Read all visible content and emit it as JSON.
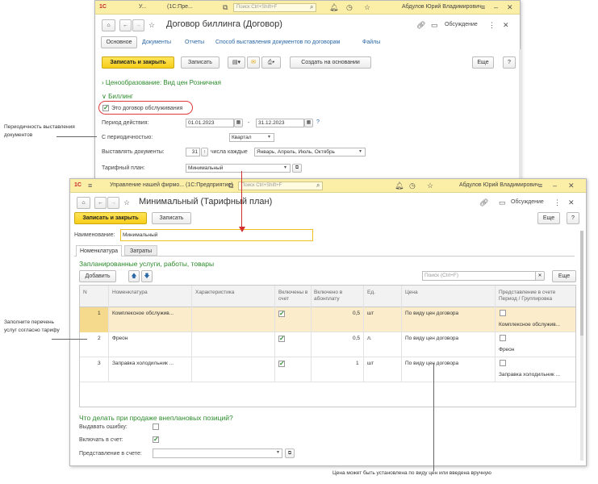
{
  "back_window": {
    "title_short": "У...",
    "app_short": "(1С:Пре...",
    "search_placeholder": "Поиск Ctrl+Shift+F",
    "user": "Абдулов Юрий Владимирович",
    "doc_title": "Договор биллинга (Договор)",
    "discussion": "Обсуждение",
    "tabs": [
      "Основное",
      "Документы",
      "Отчеты",
      "Способ выставления документов по договорам",
      "Файлы"
    ],
    "btn_save_close": "Записать и закрыть",
    "btn_save": "Записать",
    "btn_create_basis": "Создать на основании",
    "btn_more": "Еще",
    "btn_help": "?",
    "pricing_header": "Ценообразование: Вид цен Розничная",
    "billing_header": "Биллинг",
    "service_contract_label": "Это договор обслуживания",
    "period_label": "Период действия:",
    "period_from": "01.01.2023",
    "period_dash": "-",
    "period_to": "31.12.2023",
    "period_help": "?",
    "periodicity_label": "С периодичностью:",
    "periodicity_value": "Квартал",
    "issue_label": "Выставлять документы:",
    "issue_day": "31",
    "issue_text": "числа каждые",
    "issue_months": "Январь, Апрель, Июль, Октябрь",
    "tariff_label": "Тарифный план:",
    "tariff_value": "Минимальный"
  },
  "front_window": {
    "title": "Управление нашей фирмо... (1С:Предприятие)",
    "search_placeholder": "Поиск Ctrl+Shift+F",
    "user": "Абдулов Юрий Владимирович",
    "doc_title": "Минимальный (Тарифный план)",
    "discussion": "Обсуждение",
    "btn_save_close": "Записать и закрыть",
    "btn_save": "Записать",
    "btn_more": "Еще",
    "btn_help": "?",
    "name_label": "Наименование:",
    "name_value": "Минимальный",
    "tabs": [
      "Номенклатура",
      "Затраты"
    ],
    "section_title": "Запланированные услуги, работы, товары",
    "btn_add": "Добавить",
    "table_search_placeholder": "Поиск (Ctrl+F)",
    "table_more": "Еще",
    "columns": {
      "n": "N",
      "nom": "Номенклатура",
      "char": "Характеристика",
      "incl": "Включены в счет",
      "sub": "Включено в абонплату",
      "unit": "Ед.",
      "price": "Цена",
      "repr": "Представление в счете Период / Группировка"
    },
    "rows": [
      {
        "n": "1",
        "nom": "Комплексное обслужив...",
        "sub": "0,5",
        "unit": "шт",
        "price": "По виду цен договора",
        "repr": "Комплексное обслужив..."
      },
      {
        "n": "2",
        "nom": "Фреон",
        "sub": "0,5",
        "unit": "л.",
        "price": "По виду цен договора",
        "repr": "Фреон"
      },
      {
        "n": "3",
        "nom": "Заправка холодильник ...",
        "sub": "1",
        "unit": "шт",
        "price": "По виду цен договора",
        "repr": "Заправка холодильник ..."
      }
    ],
    "unplanned_title": "Что делать при продаже внеплановых позиций?",
    "issue_error_label": "Выдавать ошибку:",
    "include_label": "Включать в счет:",
    "repr_label": "Представление в счете:"
  },
  "annotations": {
    "periodicity": "Периодичность выставления документов",
    "fill_list": "Заполните перечень услуг согласно тарифу",
    "price_note": "Цена может быть установлена по виду цен или введена вручную"
  },
  "colors": {
    "titlebar": "#fbeea6",
    "accent_yellow": "#f7cd1a",
    "selected_row": "#fbeccb",
    "green_text": "#2b8a2b",
    "link": "#2a67a6",
    "highlight_red": "#e03a3a"
  }
}
